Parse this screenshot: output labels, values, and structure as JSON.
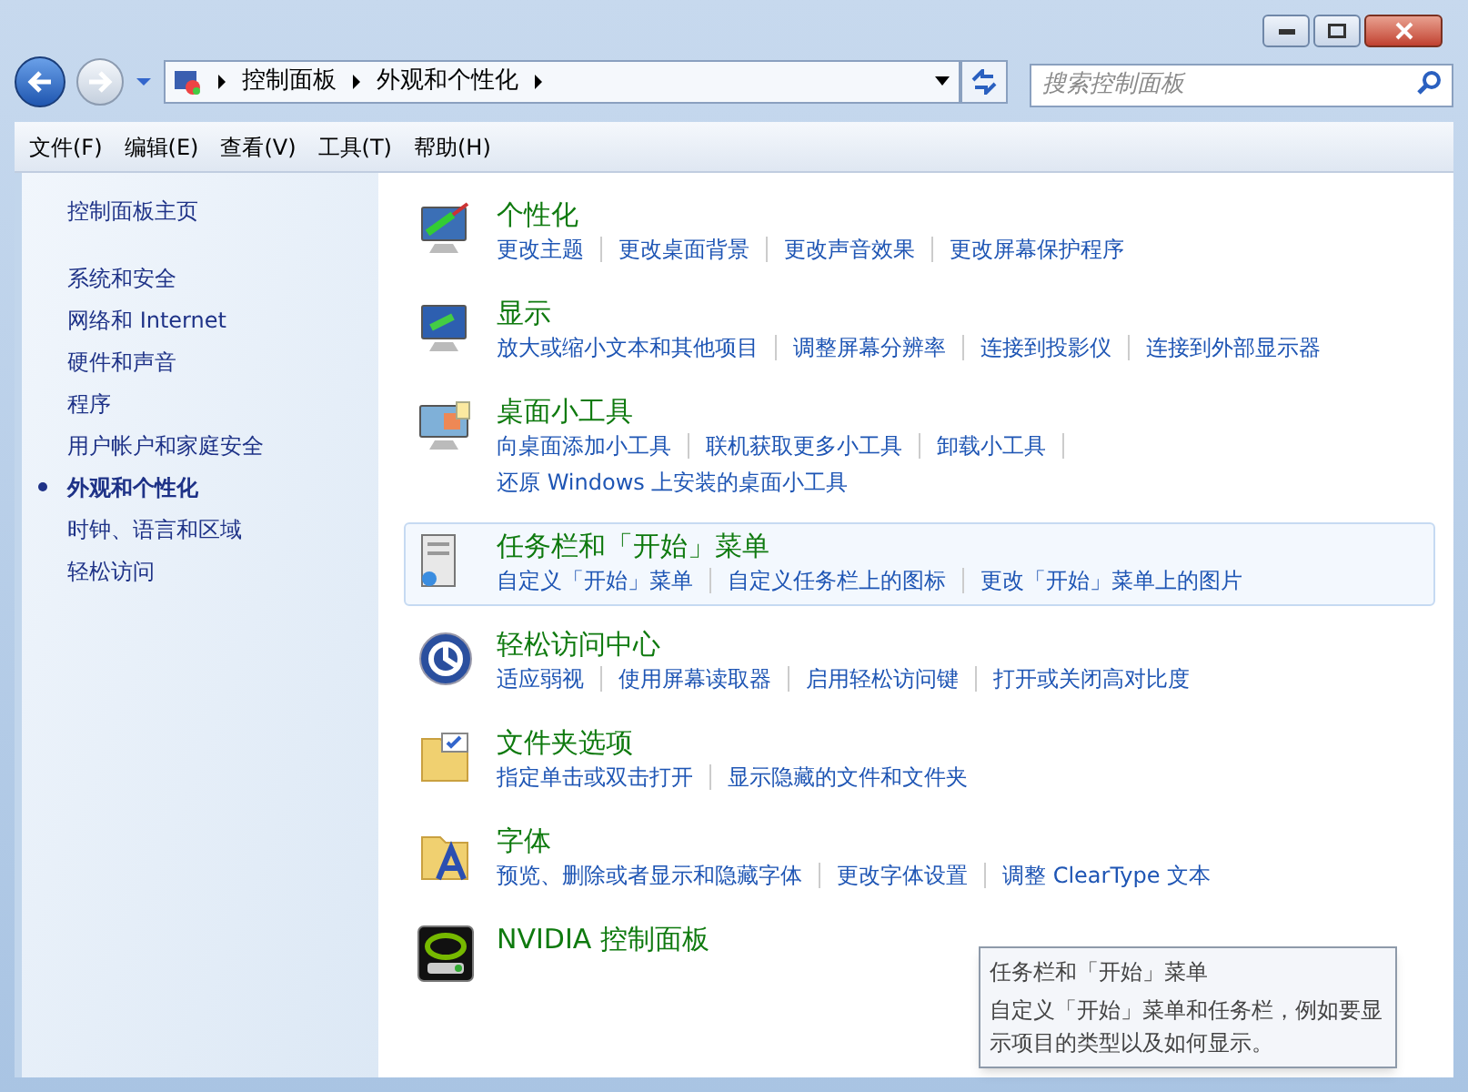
{
  "address_bar": {
    "breadcrumbs": [
      "控制面板",
      "外观和个性化"
    ]
  },
  "search": {
    "placeholder": "搜索控制面板"
  },
  "menu_bar": [
    "文件(F)",
    "编辑(E)",
    "查看(V)",
    "工具(T)",
    "帮助(H)"
  ],
  "sidebar": {
    "home": "控制面板主页",
    "items": [
      {
        "label": "系统和安全",
        "selected": false
      },
      {
        "label": "网络和 Internet",
        "selected": false
      },
      {
        "label": "硬件和声音",
        "selected": false
      },
      {
        "label": "程序",
        "selected": false
      },
      {
        "label": "用户帐户和家庭安全",
        "selected": false
      },
      {
        "label": "外观和个性化",
        "selected": true
      },
      {
        "label": "时钟、语言和区域",
        "selected": false
      },
      {
        "label": "轻松访问",
        "selected": false
      }
    ]
  },
  "sections": [
    {
      "title": "个性化",
      "highlighted": false,
      "links": [
        "更改主题",
        "更改桌面背景",
        "更改声音效果",
        "更改屏幕保护程序"
      ]
    },
    {
      "title": "显示",
      "highlighted": false,
      "links": [
        "放大或缩小文本和其他项目",
        "调整屏幕分辨率",
        "连接到投影仪",
        "连接到外部显示器"
      ]
    },
    {
      "title": "桌面小工具",
      "highlighted": false,
      "links": [
        "向桌面添加小工具",
        "联机获取更多小工具",
        "卸载小工具",
        "还原 Windows 上安装的桌面小工具"
      ]
    },
    {
      "title": "任务栏和「开始」菜单",
      "highlighted": true,
      "links": [
        "自定义「开始」菜单",
        "自定义任务栏上的图标",
        "更改「开始」菜单上的图片"
      ]
    },
    {
      "title": "轻松访问中心",
      "highlighted": false,
      "links": [
        "适应弱视",
        "使用屏幕读取器",
        "启用轻松访问键",
        "打开或关闭高对比度"
      ]
    },
    {
      "title": "文件夹选项",
      "highlighted": false,
      "links": [
        "指定单击或双击打开",
        "显示隐藏的文件和文件夹"
      ]
    },
    {
      "title": "字体",
      "highlighted": false,
      "links": [
        "预览、删除或者显示和隐藏字体",
        "更改字体设置",
        "调整 ClearType 文本"
      ]
    },
    {
      "title": "NVIDIA 控制面板",
      "highlighted": false
    }
  ],
  "tooltip": {
    "title": "任务栏和「开始」菜单",
    "body": "自定义「开始」菜单和任务栏，例如要显示项目的类型以及如何显示。"
  }
}
